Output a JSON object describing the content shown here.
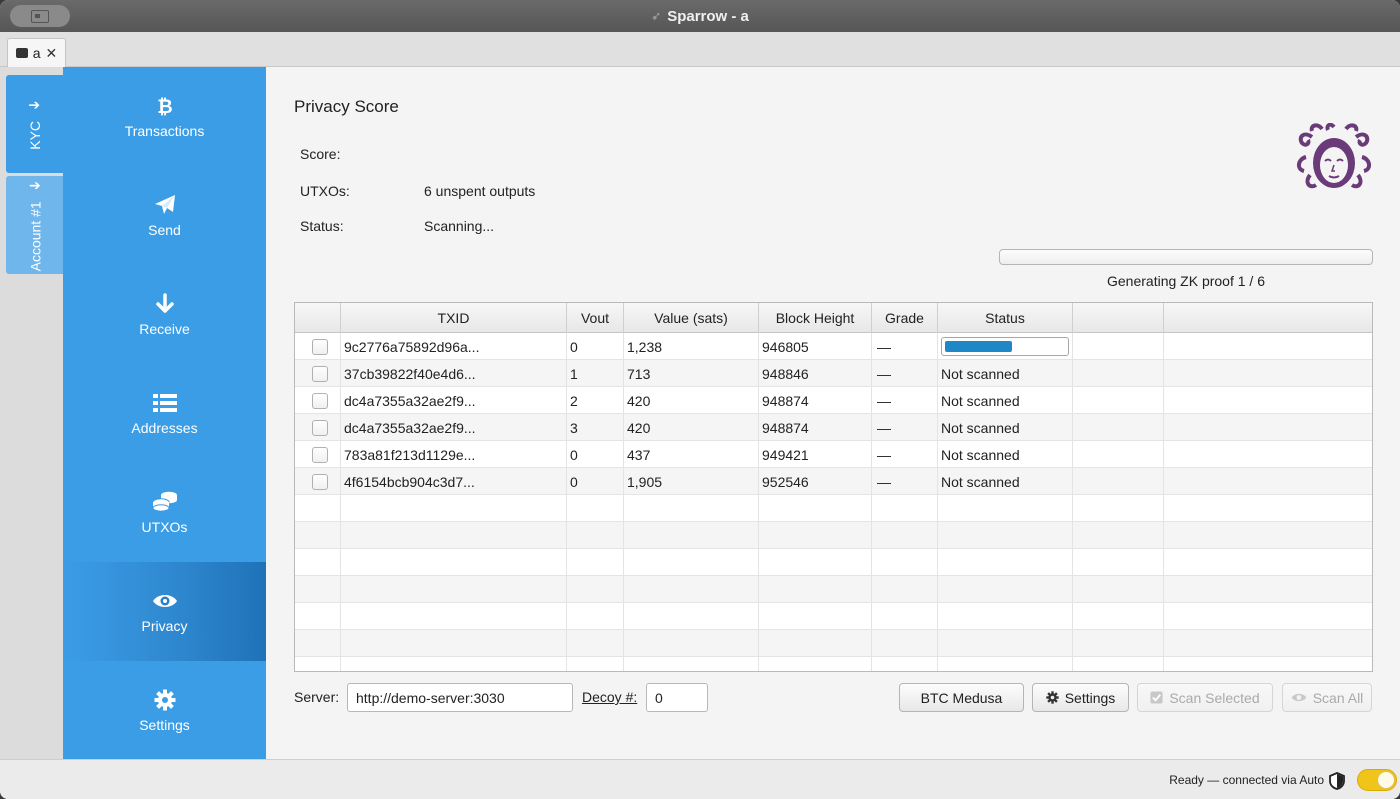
{
  "window": {
    "title": "Sparrow - a"
  },
  "tabs": [
    {
      "label": "a"
    }
  ],
  "accounts": [
    {
      "label": "KYC",
      "active": true
    },
    {
      "label": "Account #1",
      "active": false
    }
  ],
  "nav": [
    {
      "label": "Transactions",
      "icon": "bitcoin-icon"
    },
    {
      "label": "Send",
      "icon": "send-icon"
    },
    {
      "label": "Receive",
      "icon": "arrow-down-icon"
    },
    {
      "label": "Addresses",
      "icon": "list-icon"
    },
    {
      "label": "UTXOs",
      "icon": "coins-icon"
    },
    {
      "label": "Privacy",
      "icon": "eye-icon",
      "active": true
    },
    {
      "label": "Settings",
      "icon": "gear-icon"
    }
  ],
  "privacy": {
    "heading": "Privacy Score",
    "score_label": "Score:",
    "score_value": "",
    "utxos_label": "UTXOs:",
    "utxos_value": "6 unspent outputs",
    "status_label": "Status:",
    "status_value": "Scanning...",
    "progress_caption": "Generating ZK proof 1 / 6",
    "progress_fraction": 0
  },
  "table": {
    "columns": [
      "",
      "TXID",
      "Vout",
      "Value (sats)",
      "Block Height",
      "Grade",
      "Status",
      "",
      ""
    ],
    "rows": [
      {
        "txid": "9c2776a75892d96a...",
        "vout": "0",
        "value": "1,238",
        "height": "946805",
        "grade": "—",
        "status": "",
        "status_progress": 0.55
      },
      {
        "txid": "37cb39822f40e4d6...",
        "vout": "1",
        "value": "713",
        "height": "948846",
        "grade": "—",
        "status": "Not scanned"
      },
      {
        "txid": "dc4a7355a32ae2f9...",
        "vout": "2",
        "value": "420",
        "height": "948874",
        "grade": "—",
        "status": "Not scanned"
      },
      {
        "txid": "dc4a7355a32ae2f9...",
        "vout": "3",
        "value": "420",
        "height": "948874",
        "grade": "—",
        "status": "Not scanned"
      },
      {
        "txid": "783a81f213d1129e...",
        "vout": "0",
        "value": "437",
        "height": "949421",
        "grade": "—",
        "status": "Not scanned"
      },
      {
        "txid": "4f6154bcb904c3d7...",
        "vout": "0",
        "value": "1,905",
        "height": "952546",
        "grade": "—",
        "status": "Not scanned"
      }
    ]
  },
  "controls": {
    "server_label": "Server:",
    "server_value": "http://demo-server:3030",
    "decoy_label": "Decoy #:",
    "decoy_value": "0",
    "medusa_button": "BTC Medusa",
    "settings_button": "Settings",
    "scan_selected_button": "Scan Selected",
    "scan_all_button": "Scan All"
  },
  "statusbar": {
    "text": "Ready — connected via Auto",
    "toggle_on": true
  },
  "colors": {
    "accent": "#3b9de6",
    "nav_active": "#1f72b8",
    "progress": "#1f87c6",
    "toggle": "#f0c419"
  }
}
